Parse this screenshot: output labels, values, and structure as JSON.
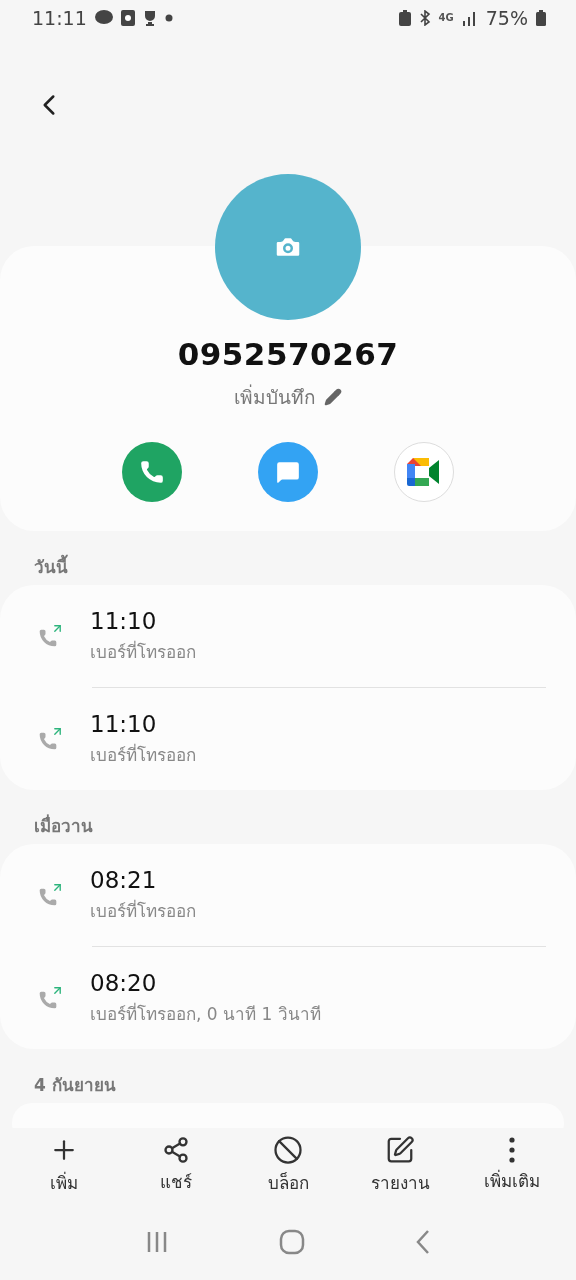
{
  "status_bar": {
    "time": "11:11",
    "network": "4G",
    "battery": "75%"
  },
  "contact": {
    "number": "0952570267",
    "note_action": "เพิ่มบันทึก"
  },
  "sections": [
    {
      "title": "วันนี้",
      "calls": [
        {
          "time": "11:10",
          "detail": "เบอร์ที่โทรออก",
          "kind": "outgoing"
        },
        {
          "time": "11:10",
          "detail": "เบอร์ที่โทรออก",
          "kind": "outgoing"
        }
      ]
    },
    {
      "title": "เมื่อวาน",
      "calls": [
        {
          "time": "08:21",
          "detail": "เบอร์ที่โทรออก",
          "kind": "outgoing"
        },
        {
          "time": "08:20",
          "detail": "เบอร์ที่โทรออก, 0 นาที 1 วินาที",
          "kind": "outgoing"
        }
      ]
    },
    {
      "title": "4 กันยายน"
    }
  ],
  "toolbar": [
    {
      "label": "เพิ่ม",
      "kind": "add"
    },
    {
      "label": "แชร์",
      "kind": "share"
    },
    {
      "label": "บล็อก",
      "kind": "block"
    },
    {
      "label": "รายงาน",
      "kind": "report"
    },
    {
      "label": "เพิ่มเติม",
      "kind": "more"
    }
  ]
}
